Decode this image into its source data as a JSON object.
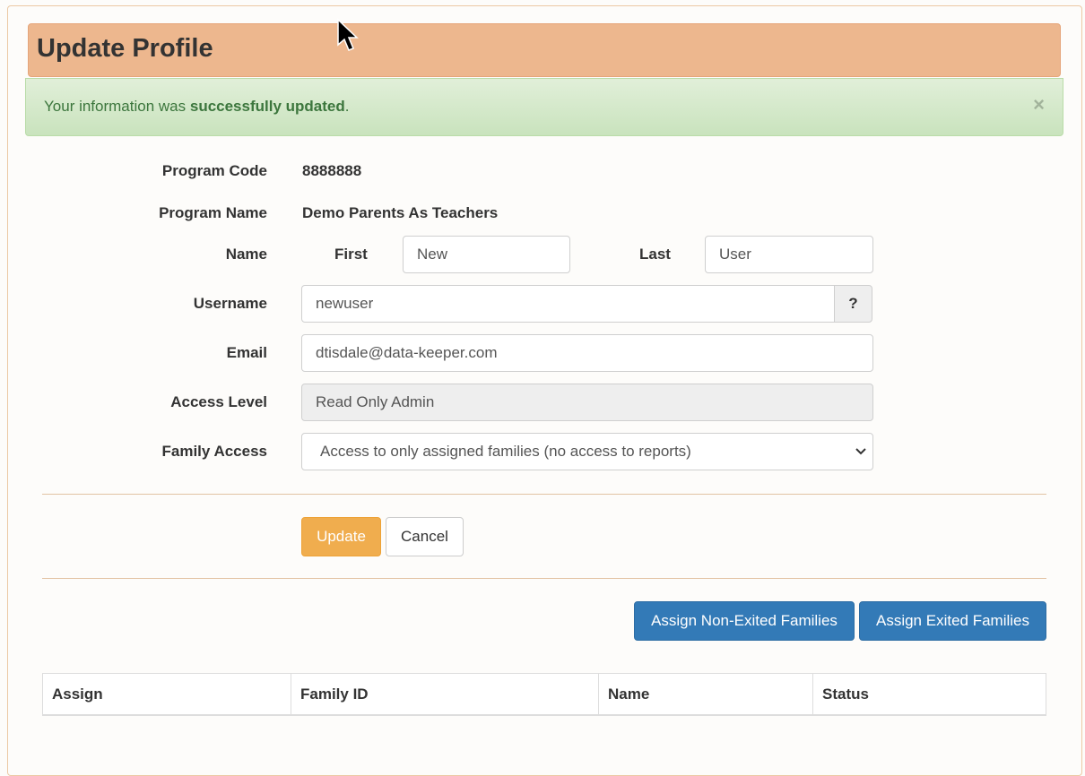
{
  "header": {
    "title": "Update Profile"
  },
  "alert": {
    "prefix": "Your information was ",
    "emphasis": "successfully updated",
    "suffix": ".",
    "close": "×"
  },
  "form": {
    "program_code": {
      "label": "Program Code",
      "value": "8888888"
    },
    "program_name": {
      "label": "Program Name",
      "value": "Demo Parents As Teachers"
    },
    "name": {
      "label": "Name",
      "first_label": "First",
      "first_value": "New",
      "last_label": "Last",
      "last_value": "User"
    },
    "username": {
      "label": "Username",
      "value": "newuser",
      "help": "?"
    },
    "email": {
      "label": "Email",
      "value": "dtisdale@data-keeper.com"
    },
    "access_level": {
      "label": "Access Level",
      "value": "Read Only Admin"
    },
    "family_access": {
      "label": "Family Access",
      "value": "Access to only assigned families (no access to reports)"
    }
  },
  "actions": {
    "update": "Update",
    "cancel": "Cancel"
  },
  "assign_buttons": {
    "non_exited": "Assign Non-Exited Families",
    "exited": "Assign Exited Families"
  },
  "table": {
    "columns": [
      "Assign",
      "Family ID",
      "Name",
      "Status"
    ]
  },
  "colors": {
    "header_bg": "#edb78e",
    "alert_bg": "#d6ebcb",
    "alert_text": "#3c763d",
    "update_btn": "#f0ad4e",
    "primary_btn": "#337ab7"
  }
}
